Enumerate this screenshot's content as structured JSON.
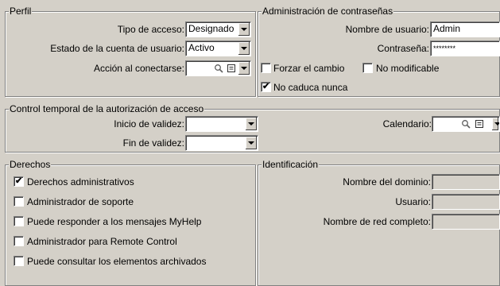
{
  "perfil": {
    "title": "Perfil",
    "tipo_acceso_label": "Tipo de acceso:",
    "tipo_acceso_value": "Designado",
    "estado_label": "Estado de la cuenta de usuario:",
    "estado_value": "Activo",
    "accion_label": "Acción al conectarse:",
    "accion_value": ""
  },
  "passwords": {
    "title": "Administración de contraseñas",
    "usuario_label": "Nombre de usuario:",
    "usuario_value": "Admin",
    "contrasena_label": "Contraseña:",
    "contrasena_value": "********",
    "forzar_label": "Forzar el cambio",
    "forzar_checked": false,
    "no_modificable_label": "No modificable",
    "no_modificable_checked": false,
    "no_caduca_label": "No caduca nunca",
    "no_caduca_checked": true
  },
  "control": {
    "title": "Control temporal de la autorización de acceso",
    "inicio_label": "Inicio de validez:",
    "inicio_value": "",
    "fin_label": "Fin de validez:",
    "fin_value": "",
    "calendario_label": "Calendario:",
    "calendario_value": ""
  },
  "derechos": {
    "title": "Derechos",
    "items": [
      {
        "label": "Derechos administrativos",
        "checked": true
      },
      {
        "label": "Administrador de soporte",
        "checked": false
      },
      {
        "label": "Puede responder a los mensajes MyHelp",
        "checked": false
      },
      {
        "label": "Administrador para Remote Control",
        "checked": false
      },
      {
        "label": "Puede consultar los elementos archivados",
        "checked": false
      }
    ]
  },
  "identificacion": {
    "title": "Identificación",
    "dominio_label": "Nombre del dominio:",
    "dominio_value": "",
    "usuario_label": "Usuario:",
    "usuario_value": "",
    "red_label": "Nombre de red completo:",
    "red_value": ""
  },
  "check_glyph": "✔"
}
